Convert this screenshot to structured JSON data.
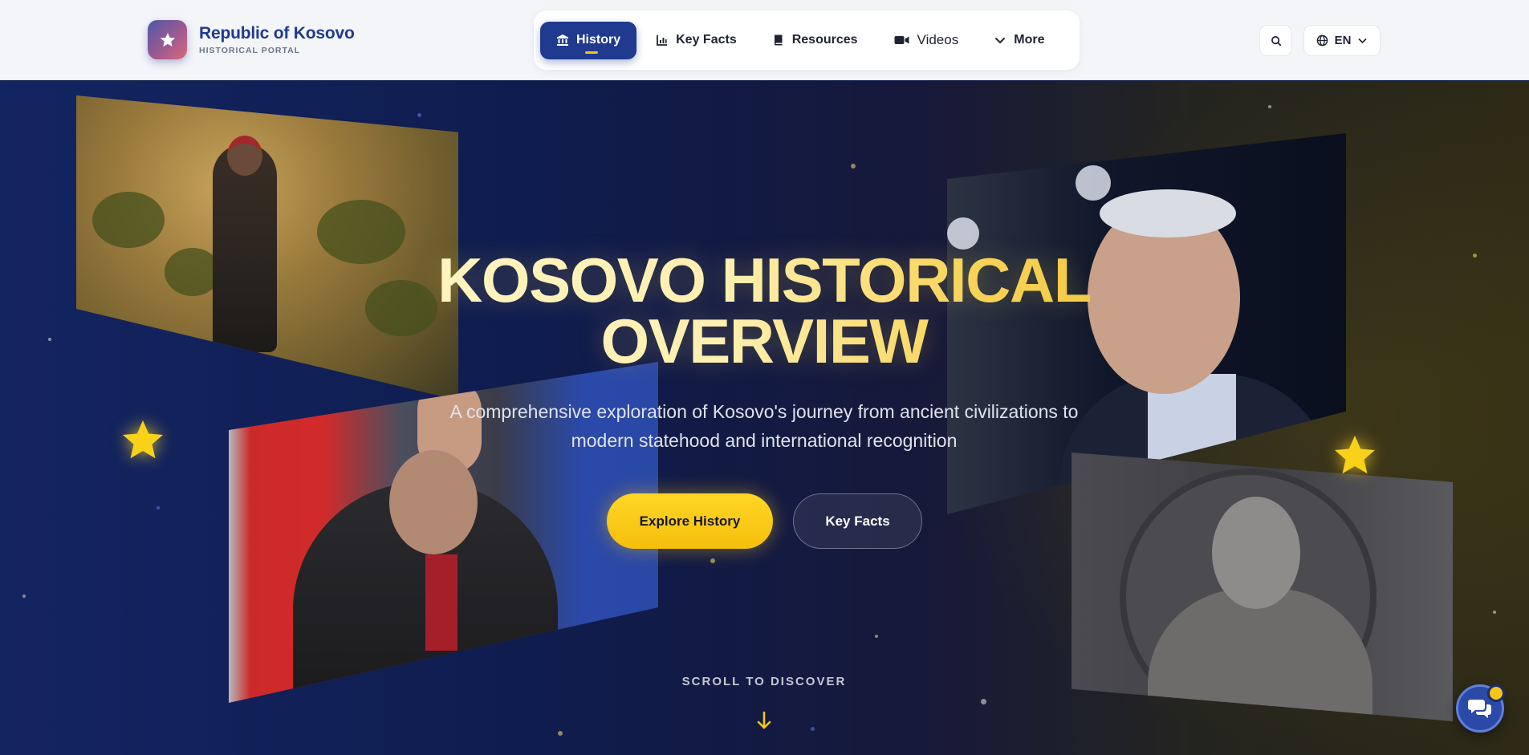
{
  "brand": {
    "name": "Republic of Kosovo",
    "subtitle": "HISTORICAL PORTAL",
    "logo_icon": "star-icon"
  },
  "nav": {
    "items": [
      {
        "label": "History",
        "icon": "landmark-icon",
        "active": true
      },
      {
        "label": "Key Facts",
        "icon": "chart-icon",
        "active": false
      },
      {
        "label": "Resources",
        "icon": "book-icon",
        "active": false
      },
      {
        "label": "Videos",
        "icon": "video-icon",
        "active": false
      },
      {
        "label": "More",
        "icon": "chevron-down-icon",
        "active": false
      }
    ]
  },
  "header_actions": {
    "search_icon": "search-icon",
    "language": "EN"
  },
  "hero": {
    "title_line1": "KOSOVO HISTORICAL",
    "title_line2": "OVERVIEW",
    "subtitle": "A comprehensive exploration of Kosovo's journey from ancient civilizations to modern statehood and international recognition",
    "primary_button": "Explore History",
    "secondary_button": "Key Facts",
    "scroll_hint": "SCROLL TO DISCOVER"
  },
  "colors": {
    "brand_blue": "#1f3a8f",
    "accent_gold": "#f5c518",
    "hero_bg": "#0f1c4e"
  }
}
